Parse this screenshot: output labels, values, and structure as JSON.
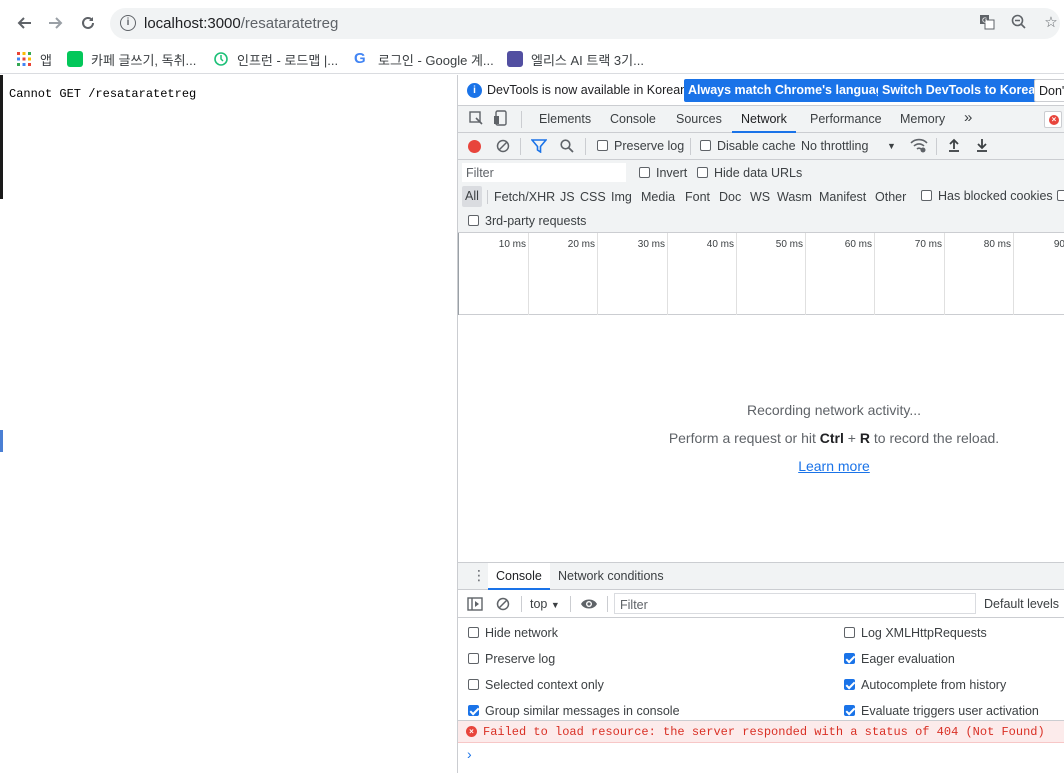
{
  "browser": {
    "url_host": "localhost:3000",
    "url_path": "/resataratetreg",
    "bookmarks": [
      {
        "label": "앱",
        "icon": "apps-grid-icon"
      },
      {
        "label": "카페 글쓰기, 독취...",
        "icon": "naver-cafe-icon"
      },
      {
        "label": "인프런 - 로드맵 |...",
        "icon": "inflearn-icon"
      },
      {
        "label": "로그인 - Google 계...",
        "icon": "google-icon"
      },
      {
        "label": "엘리스 AI 트랙 3기...",
        "icon": "elice-icon"
      }
    ]
  },
  "page": {
    "message": "Cannot GET /resataratetreg"
  },
  "devtools": {
    "infobar": {
      "text": "DevTools is now available in Korean!",
      "btn_match": "Always match Chrome's language",
      "btn_switch": "Switch DevTools to Korean",
      "btn_dont": "Don't"
    },
    "tabs": [
      "Elements",
      "Console",
      "Sources",
      "Network",
      "Performance",
      "Memory"
    ],
    "more_tabs": "»",
    "active_tab": "Network",
    "net_toolbar": {
      "preserve_log": "Preserve log",
      "disable_cache": "Disable cache",
      "throttling": "No throttling"
    },
    "filter": {
      "placeholder": "Filter",
      "invert": "Invert",
      "hide_data_urls": "Hide data URLs",
      "types": [
        "All",
        "Fetch/XHR",
        "JS",
        "CSS",
        "Img",
        "Media",
        "Font",
        "Doc",
        "WS",
        "Wasm",
        "Manifest",
        "Other"
      ],
      "has_blocked_cookies": "Has blocked cookies",
      "third_party": "3rd-party requests"
    },
    "timeline_ticks": [
      "10 ms",
      "20 ms",
      "30 ms",
      "40 ms",
      "50 ms",
      "60 ms",
      "70 ms",
      "80 ms",
      "90"
    ],
    "empty": {
      "line1": "Recording network activity...",
      "line2_prefix": "Perform a request or hit ",
      "line2_key1": "Ctrl",
      "line2_plus": " + ",
      "line2_key2": "R",
      "line2_suffix": " to record the reload.",
      "learn_more": "Learn more"
    },
    "drawer": {
      "tabs": [
        "Console",
        "Network conditions"
      ],
      "context": "top",
      "filter_placeholder": "Filter",
      "levels": "Default levels",
      "settings_left": [
        {
          "label": "Hide network",
          "checked": false
        },
        {
          "label": "Preserve log",
          "checked": false
        },
        {
          "label": "Selected context only",
          "checked": false
        },
        {
          "label": "Group similar messages in console",
          "checked": true
        }
      ],
      "settings_right": [
        {
          "label": "Log XMLHttpRequests",
          "checked": false
        },
        {
          "label": "Eager evaluation",
          "checked": true
        },
        {
          "label": "Autocomplete from history",
          "checked": true
        },
        {
          "label": "Evaluate triggers user activation",
          "checked": true
        }
      ],
      "error_message": "Failed to load resource: the server responded with a status of 404 (Not Found)",
      "prompt": "›"
    }
  },
  "colors": {
    "accent": "#1a73e8",
    "record": "#e8453c",
    "error_text": "#d93025",
    "error_bg": "#fcebeb"
  }
}
